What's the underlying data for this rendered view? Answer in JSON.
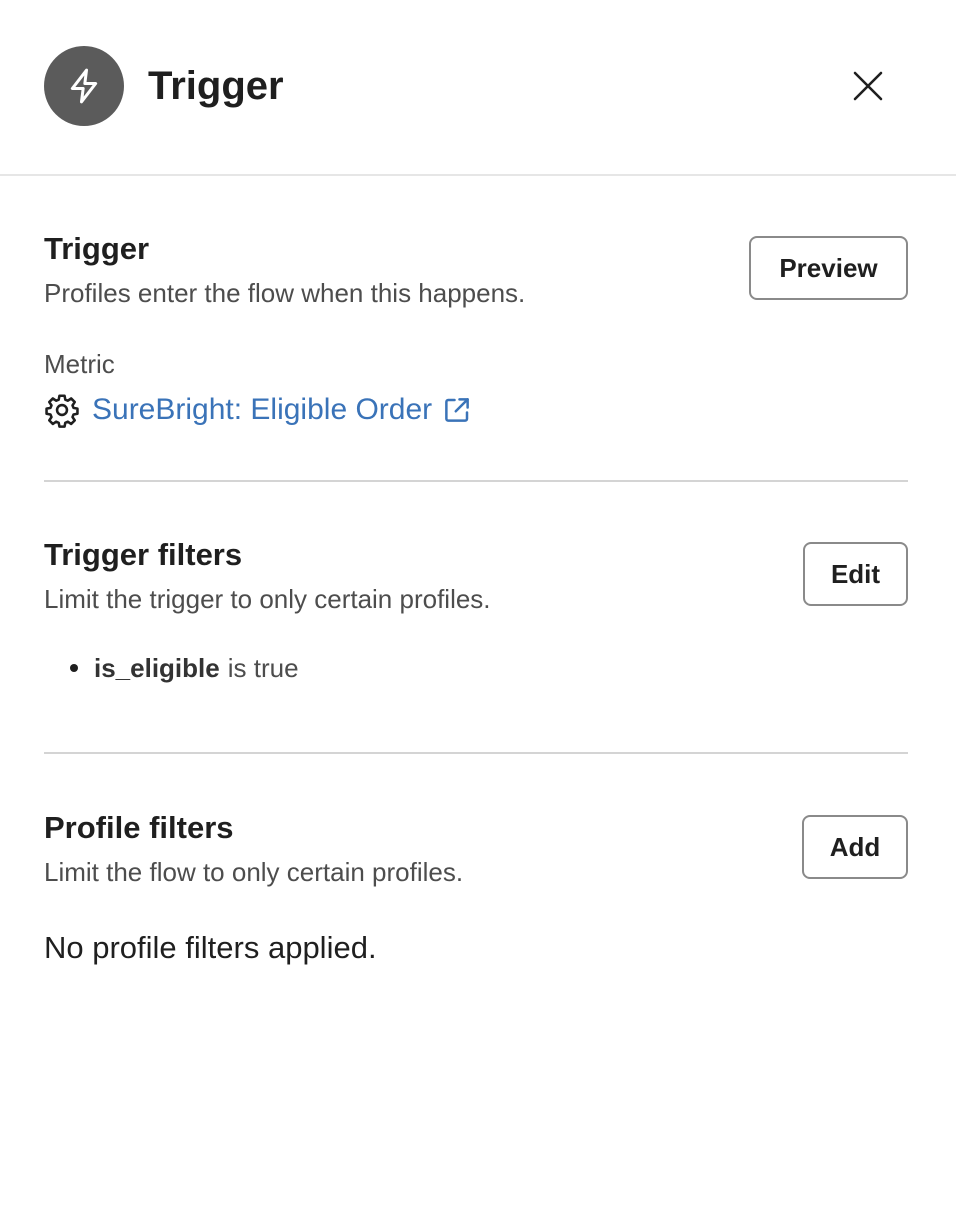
{
  "header": {
    "title": "Trigger",
    "icon": "lightning-bolt-icon",
    "close_icon": "close-icon"
  },
  "trigger": {
    "title": "Trigger",
    "description": "Profiles enter the flow when this happens.",
    "preview_label": "Preview",
    "metric_label": "Metric",
    "metric_icon": "gear-icon",
    "metric_name": "SureBright: Eligible Order",
    "metric_link_icon": "external-link-icon"
  },
  "trigger_filters": {
    "title": "Trigger filters",
    "description": "Limit the trigger to only certain profiles.",
    "edit_label": "Edit",
    "items": [
      {
        "property": "is_eligible",
        "condition": "is true"
      }
    ]
  },
  "profile_filters": {
    "title": "Profile filters",
    "description": "Limit the flow to only certain profiles.",
    "add_label": "Add",
    "empty_text": "No profile filters applied."
  },
  "colors": {
    "link": "#3a73b8",
    "icon_bg": "#5b5b5b",
    "divider": "#d4d4d4"
  }
}
